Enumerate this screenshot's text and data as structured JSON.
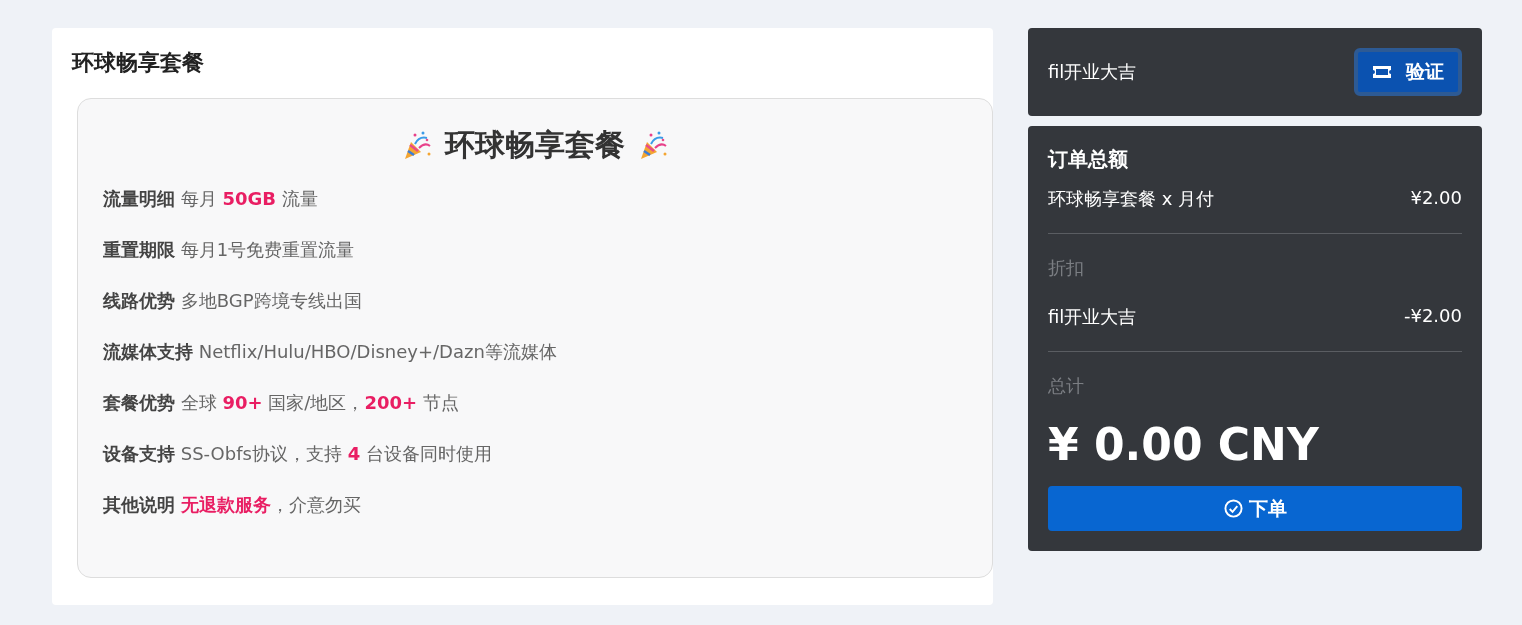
{
  "plan": {
    "title": "环球畅享套餐",
    "heading": "环球畅享套餐",
    "features": [
      {
        "label": "流量明细",
        "value": "每月 **50GB** 流量"
      },
      {
        "label": "重置期限",
        "value": "每月1号免费重置流量"
      },
      {
        "label": "线路优势",
        "value": "多地BGP跨境专线出国"
      },
      {
        "label": "流媒体支持",
        "value": "Netflix/Hulu/HBO/Disney+/Dazn等流媒体"
      },
      {
        "label": "套餐优势",
        "value": "全球 **90+** 国家/地区，**200+** 节点"
      },
      {
        "label": "设备支持",
        "value": "SS-Obfs协议，支持 **4** 台设备同时使用"
      },
      {
        "label": "其他说明",
        "value": "**无退款服务**，介意勿买"
      }
    ]
  },
  "coupon": {
    "value": "fil开业大吉",
    "button": "验证"
  },
  "order": {
    "title": "订单总额",
    "item": "环球畅享套餐 x 月付",
    "item_price": "¥2.00",
    "discount_label": "折扣",
    "discount_name": "fil开业大吉",
    "discount_amount": "-¥2.00",
    "total_label": "总计",
    "total": "¥ 0.00 CNY",
    "submit": "下单"
  }
}
